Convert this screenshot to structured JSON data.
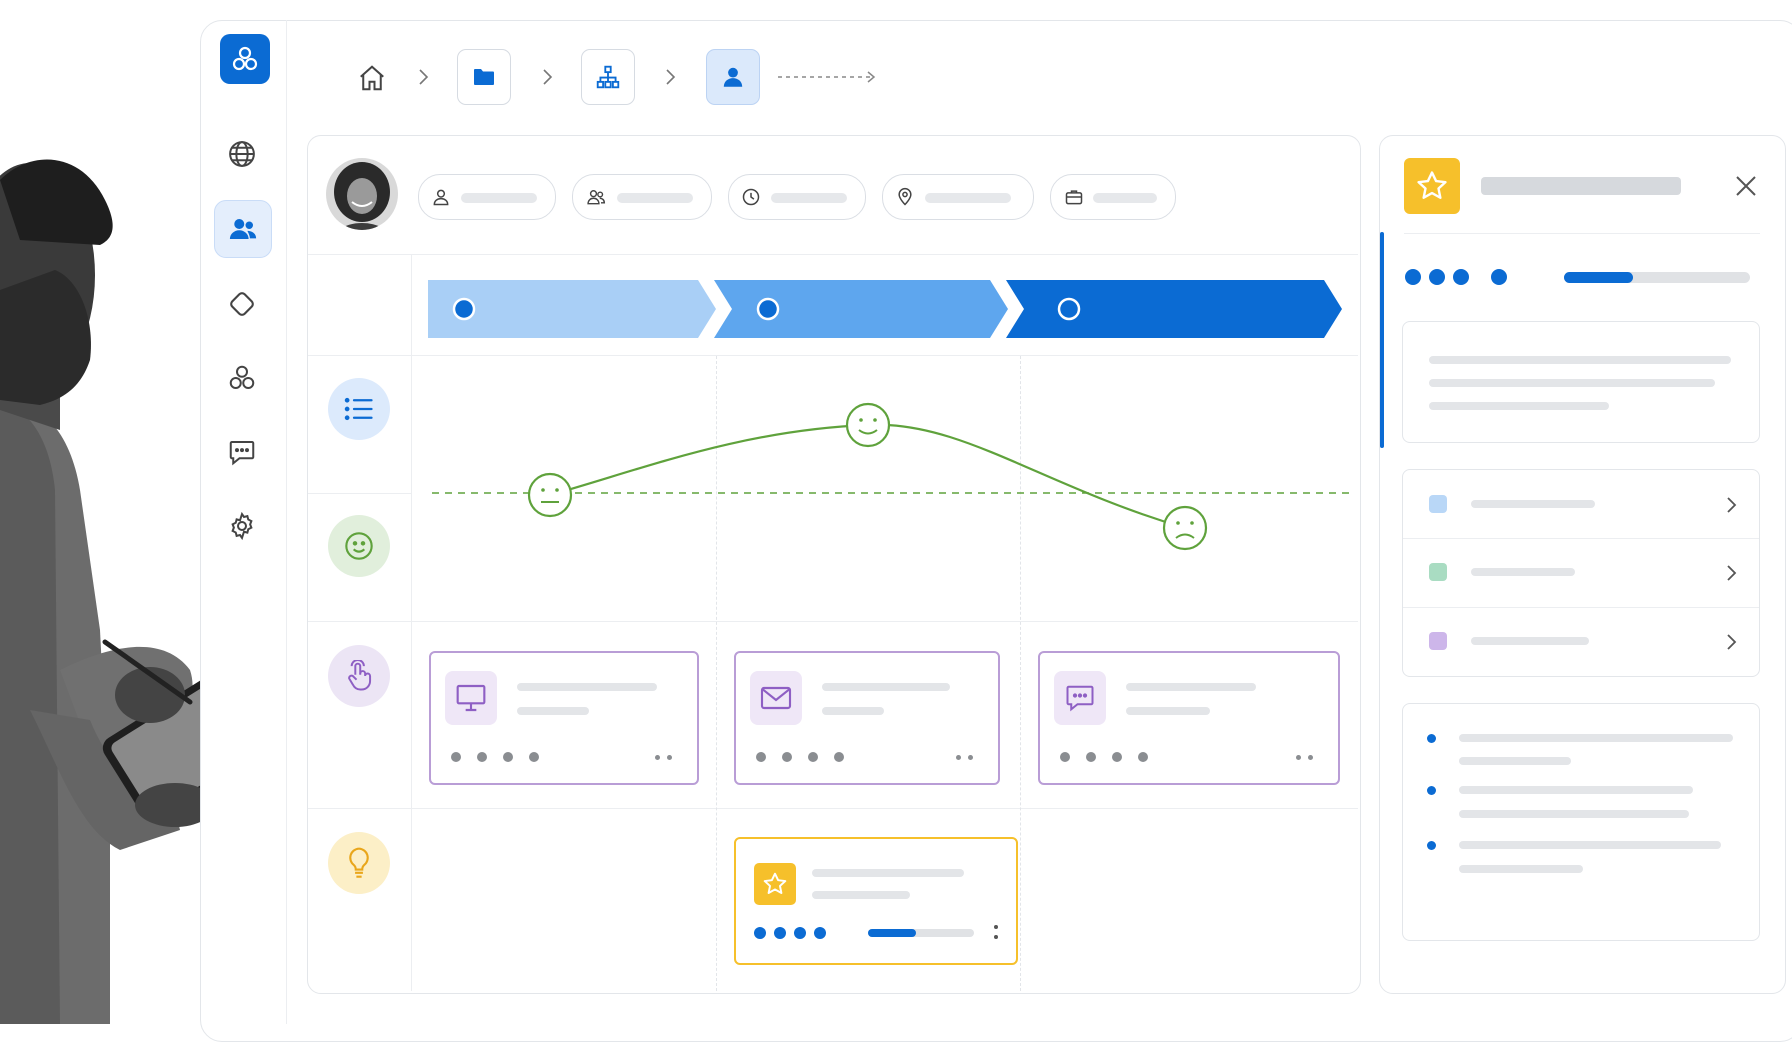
{
  "app": {
    "logo": "team-logo-icon",
    "colors": {
      "primary": "#0b6bd3",
      "accent_green": "#5fa23c",
      "accent_purple": "#b99dd6",
      "accent_yellow": "#f6c02b"
    }
  },
  "sidebar": {
    "items": [
      {
        "icon": "globe-icon"
      },
      {
        "icon": "users-icon",
        "active": true
      },
      {
        "icon": "diamond-icon"
      },
      {
        "icon": "network-icon"
      },
      {
        "icon": "chat-icon"
      },
      {
        "icon": "settings-icon"
      }
    ]
  },
  "breadcrumb": {
    "items": [
      "home-icon",
      "folder-icon",
      "org-chart-icon",
      "person-icon"
    ]
  },
  "profile": {
    "avatar": "customer-avatar",
    "attributes": [
      "person-icon",
      "group-icon",
      "clock-icon",
      "location-pin-icon",
      "briefcase-icon"
    ]
  },
  "journey": {
    "stages": [
      {
        "color": "#a9cff6"
      },
      {
        "color": "#5ea6ee"
      },
      {
        "color": "#0b6bd3"
      }
    ],
    "rows": [
      {
        "icon": "list-icon",
        "color": "#dceafc"
      },
      {
        "icon": "smile-icon",
        "color": "#e1efdc"
      },
      {
        "icon": "touch-icon",
        "color": "#ece5f5"
      },
      {
        "icon": "lightbulb-icon",
        "color": "#fcefc7"
      }
    ],
    "emotion": [
      {
        "stage": 1,
        "sentiment": "neutral"
      },
      {
        "stage": 2,
        "sentiment": "happy"
      },
      {
        "stage": 3,
        "sentiment": "sad"
      }
    ],
    "touchpoints": [
      {
        "icon": "monitor-icon"
      },
      {
        "icon": "mail-icon"
      },
      {
        "icon": "message-icon"
      }
    ],
    "opportunity": {
      "icon": "star-icon",
      "progress": 0.45
    }
  },
  "detail_panel": {
    "icon": "star-icon",
    "progress": 0.37,
    "list_colors": [
      "#b9d7f7",
      "#a9dcc2",
      "#cdb6ea"
    ]
  }
}
